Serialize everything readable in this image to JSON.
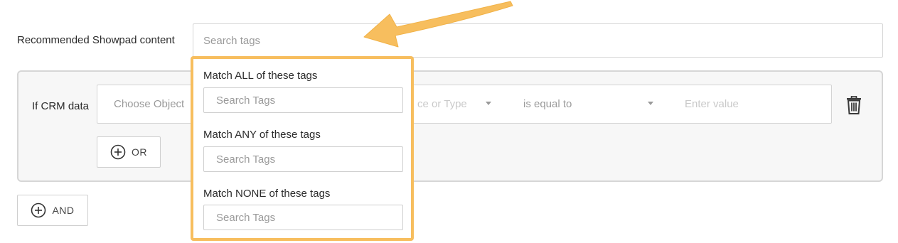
{
  "recommended": {
    "label": "Recommended Showpad content",
    "search_placeholder": "Search tags"
  },
  "crm": {
    "label": "If CRM data",
    "object_placeholder": "Choose Object",
    "field_placeholder": "ce or Type",
    "operator": "is equal to",
    "value_placeholder": "Enter value",
    "or_label": "OR"
  },
  "and_label": "AND",
  "dropdown": {
    "sections": [
      {
        "heading": "Match ALL of these tags",
        "placeholder": "Search Tags"
      },
      {
        "heading": "Match ANY of these tags",
        "placeholder": "Search Tags"
      },
      {
        "heading": "Match NONE of these tags",
        "placeholder": "Search Tags"
      }
    ]
  },
  "colors": {
    "highlight": "#f7be5e",
    "panel_bg": "#f7f7f7"
  },
  "icons": {
    "delete": "trash-icon",
    "add": "plus-circle-icon",
    "annotation": "arrow-annotation"
  }
}
